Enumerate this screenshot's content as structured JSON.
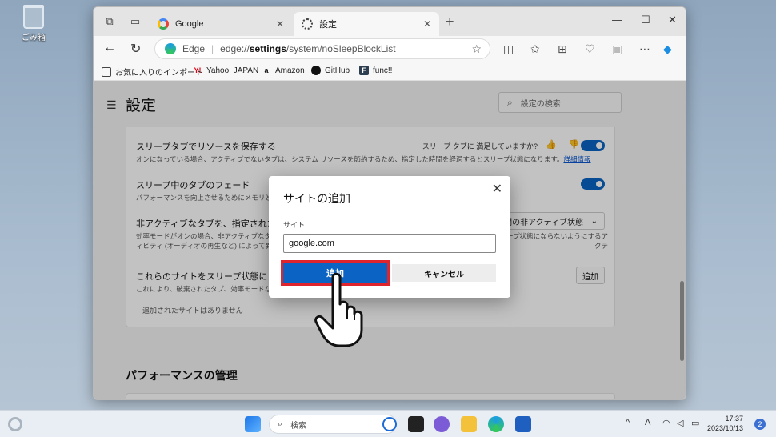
{
  "desktop": {
    "recycle_label": "ごみ箱"
  },
  "browser": {
    "tabs": [
      {
        "label": "Google",
        "active": false
      },
      {
        "label": "設定",
        "active": true
      }
    ],
    "address": {
      "brand": "Edge",
      "url_prefix": "edge://",
      "url_bold": "settings",
      "url_rest": "/system/noSleepBlockList"
    },
    "bookmarks": [
      "お気に入りのインポート",
      "Yahoo! JAPAN",
      "Amazon",
      "GitHub",
      "func!!"
    ]
  },
  "settings": {
    "title": "設定",
    "search_placeholder": "設定の検索",
    "rows": {
      "sleeping_tabs_title": "スリープタブでリソースを保存する",
      "sleeping_tabs_feedback": "スリープ タブに 満足していますか?",
      "sleeping_tabs_desc": "オンになっている場合、アクティブでないタブは、システム リソースを節約するため、指定した時間を経過するとスリープ状態になります。",
      "sleeping_tabs_link": "詳細情報",
      "fade_title": "スリープ中のタブのフェード",
      "fade_desc": "パフォーマンスを向上させるためにメモリと CPU を",
      "inactive_title": "非アクティブなタブを、指定された時間が",
      "inactive_dropdown": "時間の非アクティブ状態",
      "inactive_desc1": "効率モードがオンの場合、非アクティブなタブは",
      "inactive_desc1_right": "ープ状態にならないようにするアクテ",
      "inactive_desc2": "ィビティ (オーディオの再生など) によって異なる場",
      "never_sleep_title": "これらのサイトをスリープ状態にしない",
      "never_sleep_desc": "これにより、破棄されたタブ、効率モードなどの他",
      "never_sleep_add": "追加",
      "never_sleep_empty": "追加されたサイトはありません"
    },
    "section_performance": "パフォーマンスの管理"
  },
  "dialog": {
    "title": "サイトの追加",
    "site_label": "サイト",
    "site_value": "google.com",
    "add_button": "追加",
    "cancel_button": "キャンセル"
  },
  "taskbar": {
    "search_placeholder": "検索",
    "clock_time": "17:37",
    "clock_date": "2023/10/13",
    "ime_label": "A",
    "notification_count": "2"
  },
  "colors": {
    "accent": "#0b63c4",
    "highlight_border": "#e0242d"
  }
}
